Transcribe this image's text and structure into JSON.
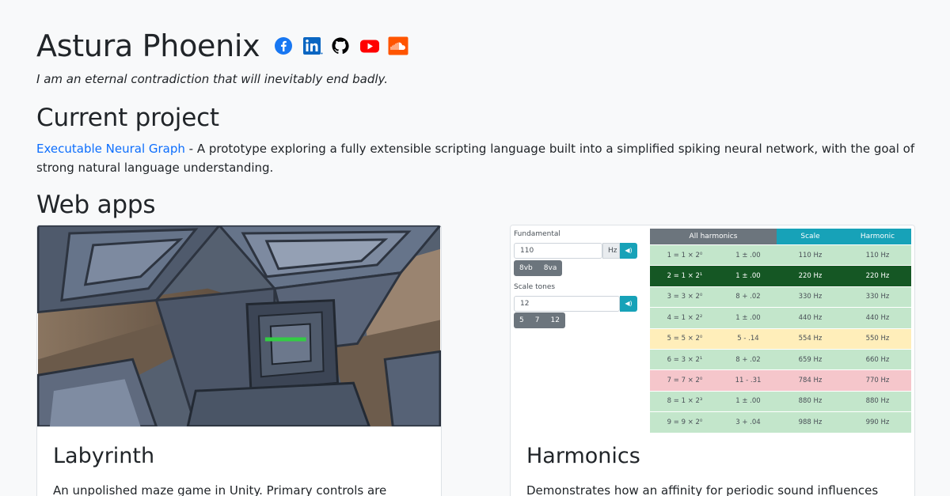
{
  "header": {
    "title": "Astura Phoenix",
    "tagline": "I am an eternal contradiction that will inevitably end badly.",
    "social": [
      {
        "name": "facebook-icon",
        "color": "#1877f2"
      },
      {
        "name": "linkedin-icon",
        "color": "#0a66c2"
      },
      {
        "name": "github-icon",
        "color": "#000000"
      },
      {
        "name": "youtube-icon",
        "color": "#ff0000"
      },
      {
        "name": "soundcloud-icon",
        "color": "#ff5500"
      }
    ]
  },
  "current": {
    "heading": "Current project",
    "link_text": "Executable Neural Graph",
    "description": " - A prototype exploring a fully extensible scripting language built into a simplified spiking neural network, with the goal of strong natural language understanding."
  },
  "webapps": {
    "heading": "Web apps",
    "cards": [
      {
        "title": "Labyrinth",
        "text": "An unpolished maze game in Unity. Primary controls are WADS"
      },
      {
        "title": "Harmonics",
        "text": "Demonstrates how an affinity for periodic sound influences our"
      }
    ]
  },
  "harmonics_shot": {
    "fundamental_label": "Fundamental",
    "fundamental_value": "110",
    "hz": "Hz",
    "octave_buttons": [
      "8vb",
      "8va"
    ],
    "scale_label": "Scale tones",
    "scale_value": "12",
    "scale_buttons": [
      "5",
      "7",
      "12"
    ],
    "headers": [
      "All harmonics",
      "Scale",
      "Harmonic"
    ],
    "rows": [
      {
        "h": "1 = 1 × 2⁰",
        "e": "1 ± .00",
        "s": "110 Hz",
        "r": "110 Hz",
        "kind": "ok"
      },
      {
        "h": "2 = 1 × 2¹",
        "e": "1 ± .00",
        "s": "220 Hz",
        "r": "220 Hz",
        "kind": "sel"
      },
      {
        "h": "3 = 3 × 2⁰",
        "e": "8 + .02",
        "s": "330 Hz",
        "r": "330 Hz",
        "kind": "ok"
      },
      {
        "h": "4 = 1 × 2²",
        "e": "1 ± .00",
        "s": "440 Hz",
        "r": "440 Hz",
        "kind": "ok"
      },
      {
        "h": "5 = 5 × 2⁰",
        "e": "5 - .14",
        "s": "554 Hz",
        "r": "550 Hz",
        "kind": "warn"
      },
      {
        "h": "6 = 3 × 2¹",
        "e": "8 + .02",
        "s": "659 Hz",
        "r": "660 Hz",
        "kind": "ok"
      },
      {
        "h": "7 = 7 × 2⁰",
        "e": "11 - .31",
        "s": "784 Hz",
        "r": "770 Hz",
        "kind": "bad"
      },
      {
        "h": "8 = 1 × 2³",
        "e": "1 ± .00",
        "s": "880 Hz",
        "r": "880 Hz",
        "kind": "ok"
      },
      {
        "h": "9 = 9 × 2⁰",
        "e": "3 + .04",
        "s": "988 Hz",
        "r": "990 Hz",
        "kind": "ok"
      }
    ],
    "colors": {
      "ok": "#c3e6cb",
      "sel": "#155724",
      "warn": "#ffeeba",
      "bad": "#f5c6cb",
      "head_gray": "#6c757d",
      "head_teal": "#17a2b8"
    }
  }
}
